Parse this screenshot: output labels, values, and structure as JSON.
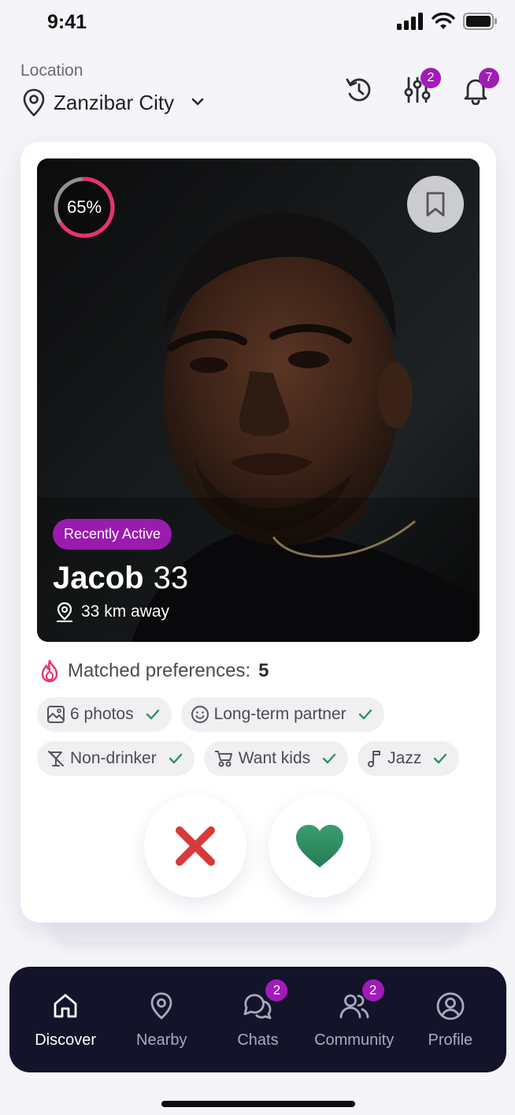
{
  "status_bar": {
    "time": "9:41"
  },
  "header": {
    "location_label": "Location",
    "location_name": "Zanzibar City",
    "filters_badge": "2",
    "notifications_badge": "7"
  },
  "profile": {
    "match_score": "65%",
    "match_score_fraction": 0.65,
    "activity": "Recently Active",
    "name": "Jacob",
    "age": "33",
    "distance": "33 km away"
  },
  "preferences": {
    "label": "Matched preferences:",
    "count": "5",
    "chips": [
      {
        "label": "6 photos",
        "icon": "photos-icon"
      },
      {
        "label": "Long-term partner",
        "icon": "smile-icon"
      },
      {
        "label": "Non-drinker",
        "icon": "no-drink-icon"
      },
      {
        "label": "Want kids",
        "icon": "stroller-icon"
      },
      {
        "label": "Jazz",
        "icon": "music-note-icon"
      }
    ]
  },
  "nav": {
    "items": [
      {
        "label": "Discover",
        "icon": "home-icon"
      },
      {
        "label": "Nearby",
        "icon": "location-pin-icon"
      },
      {
        "label": "Chats",
        "icon": "chat-icon",
        "badge": "2"
      },
      {
        "label": "Community",
        "icon": "people-icon",
        "badge": "2"
      },
      {
        "label": "Profile",
        "icon": "profile-icon"
      }
    ]
  },
  "colors": {
    "accent": "#a11bb8",
    "ring": "#e8336b",
    "like": "#2f8f63",
    "dislike": "#d73a3a",
    "nav_bg": "#13132a"
  }
}
